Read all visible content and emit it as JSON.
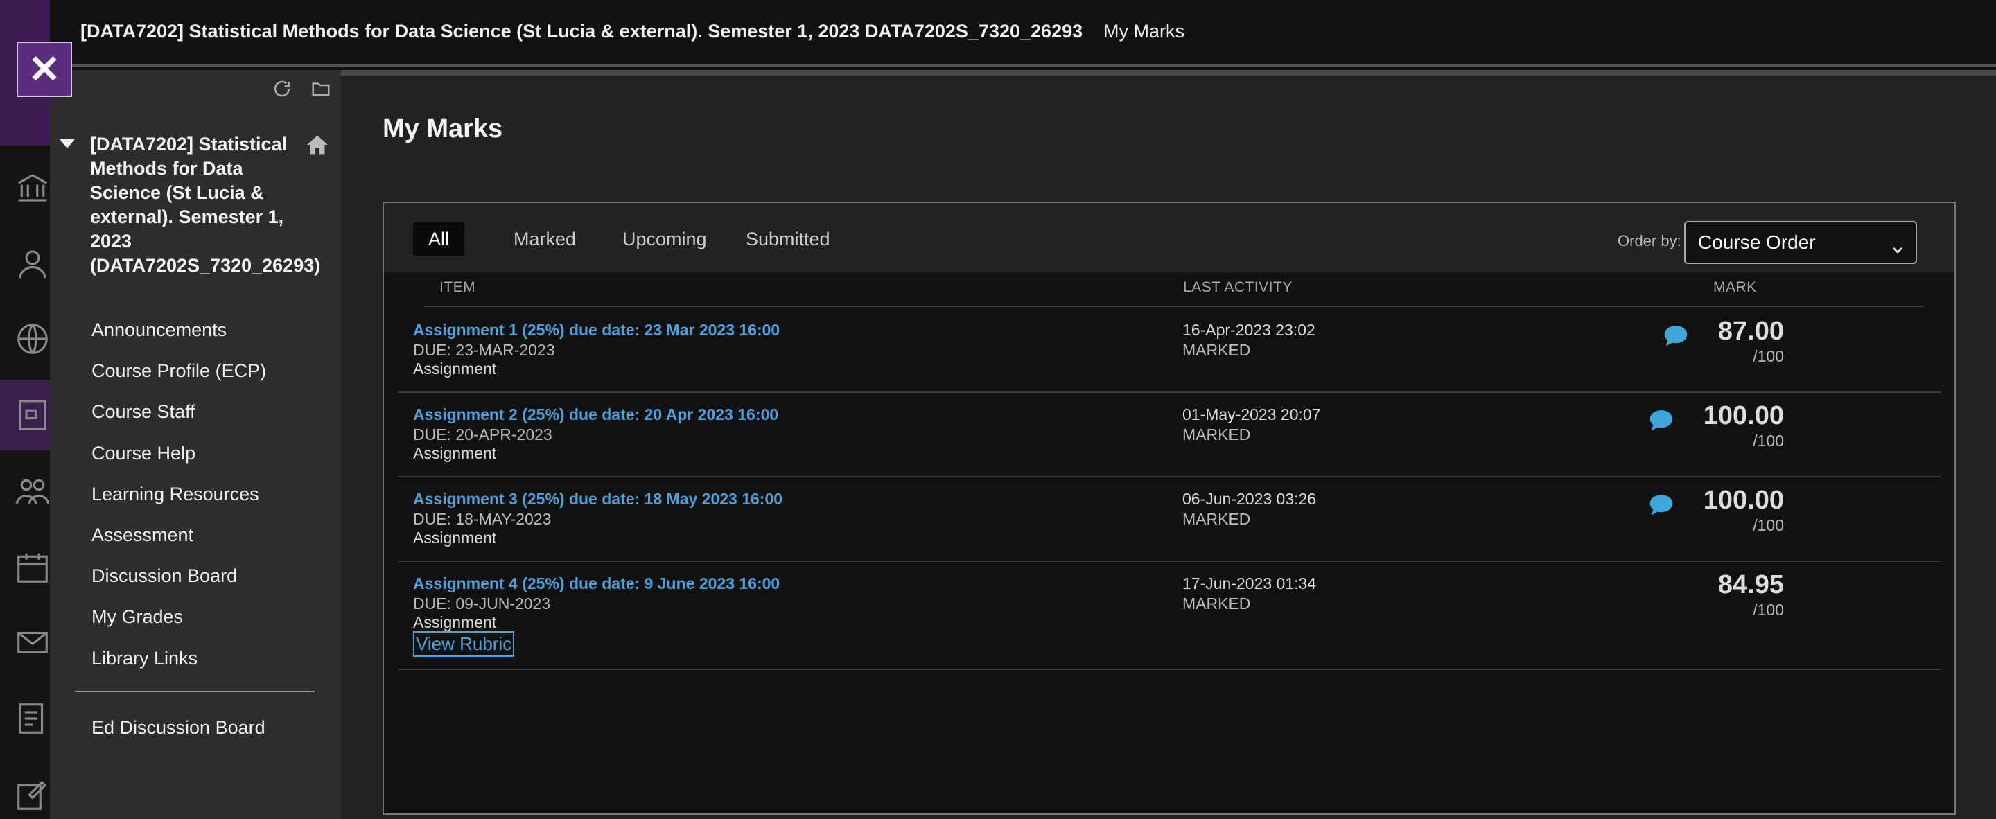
{
  "topbar": {
    "course_crumb": "[DATA7202] Statistical Methods for Data Science (St Lucia & external). Semester 1, 2023 DATA7202S_7320_26293",
    "page_crumb": "My Marks"
  },
  "close_button": "✕",
  "course_nav": {
    "title": "[DATA7202] Statistical Methods for Data Science (St Lucia & external). Semester 1, 2023 (DATA7202S_7320_26293)",
    "items": [
      "Announcements",
      "Course Profile (ECP)",
      "Course Staff",
      "Course Help",
      "Learning Resources",
      "Assessment",
      "Discussion Board",
      "My Grades",
      "Library Links"
    ],
    "extra_item": "Ed Discussion Board"
  },
  "main": {
    "title": "My Marks",
    "tabs": [
      "All",
      "Marked",
      "Upcoming",
      "Submitted"
    ],
    "active_tab": "All",
    "order_label": "Order by:",
    "order_value": "Course Order",
    "columns": {
      "item": "ITEM",
      "last_activity": "LAST ACTIVITY",
      "mark": "MARK"
    },
    "rows": [
      {
        "title": "Assignment 1 (25%) due date: 23 Mar 2023 16:00",
        "due": "DUE: 23-MAR-2023",
        "type": "Assignment",
        "activity_date": "16-Apr-2023 23:02",
        "activity_status": "MARKED",
        "mark": "87.00",
        "out_of": "/100",
        "has_comment": true
      },
      {
        "title": "Assignment 2 (25%) due date: 20 Apr 2023 16:00",
        "due": "DUE: 20-APR-2023",
        "type": "Assignment",
        "activity_date": "01-May-2023 20:07",
        "activity_status": "MARKED",
        "mark": "100.00",
        "out_of": "/100",
        "has_comment": true
      },
      {
        "title": "Assignment 3 (25%) due date: 18 May 2023 16:00",
        "due": "DUE: 18-MAY-2023",
        "type": "Assignment",
        "activity_date": "06-Jun-2023 03:26",
        "activity_status": "MARKED",
        "mark": "100.00",
        "out_of": "/100",
        "has_comment": true
      },
      {
        "title": "Assignment 4 (25%) due date: 9 June 2023 16:00",
        "due": "DUE: 09-JUN-2023",
        "type": "Assignment",
        "activity_date": "17-Jun-2023 01:34",
        "activity_status": "MARKED",
        "mark": "84.95",
        "out_of": "/100",
        "has_comment": false,
        "rubric_link": "View Rubric"
      }
    ]
  },
  "colors": {
    "accent_purple": "#5a2d80",
    "link_blue": "#4aa3df",
    "comment_blue": "#3ea6d8"
  }
}
